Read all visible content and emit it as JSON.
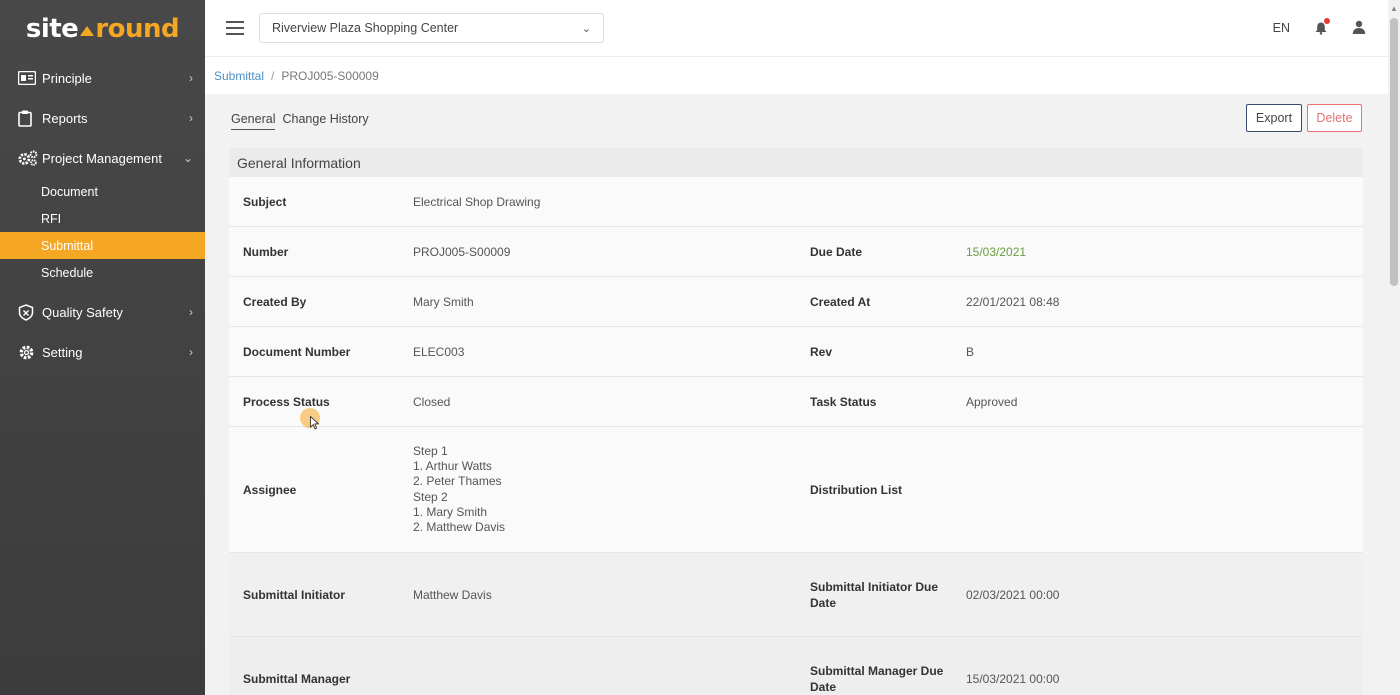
{
  "logo": {
    "part1": "site",
    "part2": "round"
  },
  "sidebar": {
    "items": [
      {
        "label": "Principle",
        "icon": "id-card-icon"
      },
      {
        "label": "Reports",
        "icon": "clipboard-icon"
      },
      {
        "label": "Project Management",
        "icon": "gears-icon"
      }
    ],
    "sub_items": [
      "Document",
      "RFI",
      "Submittal",
      "Schedule"
    ],
    "active_sub": "Submittal",
    "items_after": [
      {
        "label": "Quality Safety",
        "icon": "shield-icon"
      },
      {
        "label": "Setting",
        "icon": "gear-icon"
      }
    ]
  },
  "header": {
    "project": "Riverview Plaza Shopping Center",
    "language": "EN"
  },
  "breadcrumb": {
    "parent": "Submittal",
    "separator": "/",
    "current": "PROJ005-S00009"
  },
  "tabs": [
    "General",
    "Change History"
  ],
  "actions": {
    "export": "Export",
    "delete": "Delete"
  },
  "section_title": "General Information",
  "fields": {
    "subject_label": "Subject",
    "subject": "Electrical Shop Drawing",
    "number_label": "Number",
    "number": "PROJ005-S00009",
    "due_date_label": "Due Date",
    "due_date": "15/03/2021",
    "created_by_label": "Created By",
    "created_by": "Mary Smith",
    "created_at_label": "Created At",
    "created_at": "22/01/2021 08:48",
    "doc_number_label": "Document Number",
    "doc_number": "ELEC003",
    "rev_label": "Rev",
    "rev": "B",
    "process_status_label": "Process Status",
    "process_status": "Closed",
    "task_status_label": "Task Status",
    "task_status": "Approved",
    "assignee_label": "Assignee",
    "assignee_lines": [
      "Step 1",
      "1. Arthur Watts",
      "2. Peter Thames",
      "Step 2",
      "1. Mary Smith",
      "2. Matthew Davis"
    ],
    "distribution_label": "Distribution List",
    "initiator_label": "Submittal Initiator",
    "initiator": "Matthew Davis",
    "initiator_due_label": "Submittal Initiator Due Date",
    "initiator_due": "02/03/2021 00:00",
    "manager_label": "Submittal Manager",
    "manager": "",
    "manager_due_label": "Submittal Manager Due Date",
    "manager_due": "15/03/2021 00:00"
  },
  "colors": {
    "accent": "#f5a623",
    "sidebar": "#444444",
    "due_date": "#6a9e3f",
    "delete": "#e57373",
    "link": "#4a90c9"
  }
}
